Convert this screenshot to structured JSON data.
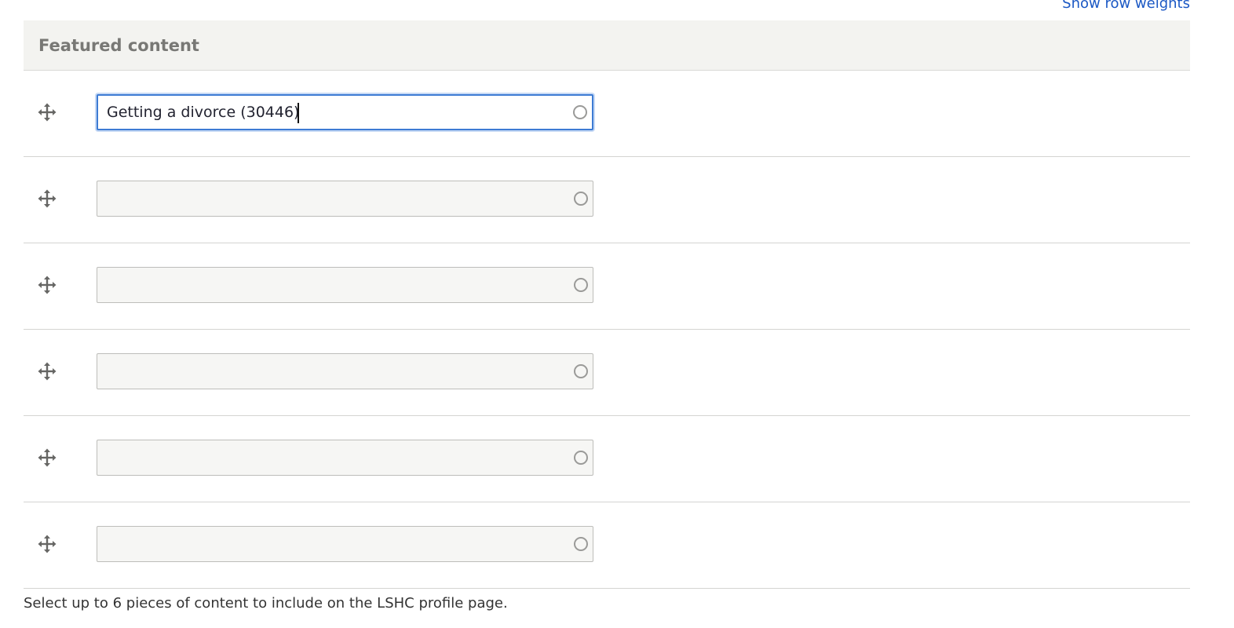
{
  "table": {
    "show_row_weights_label": "Show row weights",
    "header": "Featured content",
    "rows": [
      {
        "value": "Getting a divorce (30446)",
        "focused": true
      },
      {
        "value": ""
      },
      {
        "value": ""
      },
      {
        "value": ""
      },
      {
        "value": ""
      },
      {
        "value": ""
      }
    ]
  },
  "description": "Select up to 6 pieces of content to include on the LSHC profile page.",
  "icons": {
    "drag": "move-arrows-icon",
    "autocomplete": "autocomplete-throbber-icon"
  },
  "colors": {
    "link": "#1b58c4",
    "header_bg": "#f3f3f0",
    "header_text": "#787875",
    "focus_border": "#3d7bd4"
  }
}
